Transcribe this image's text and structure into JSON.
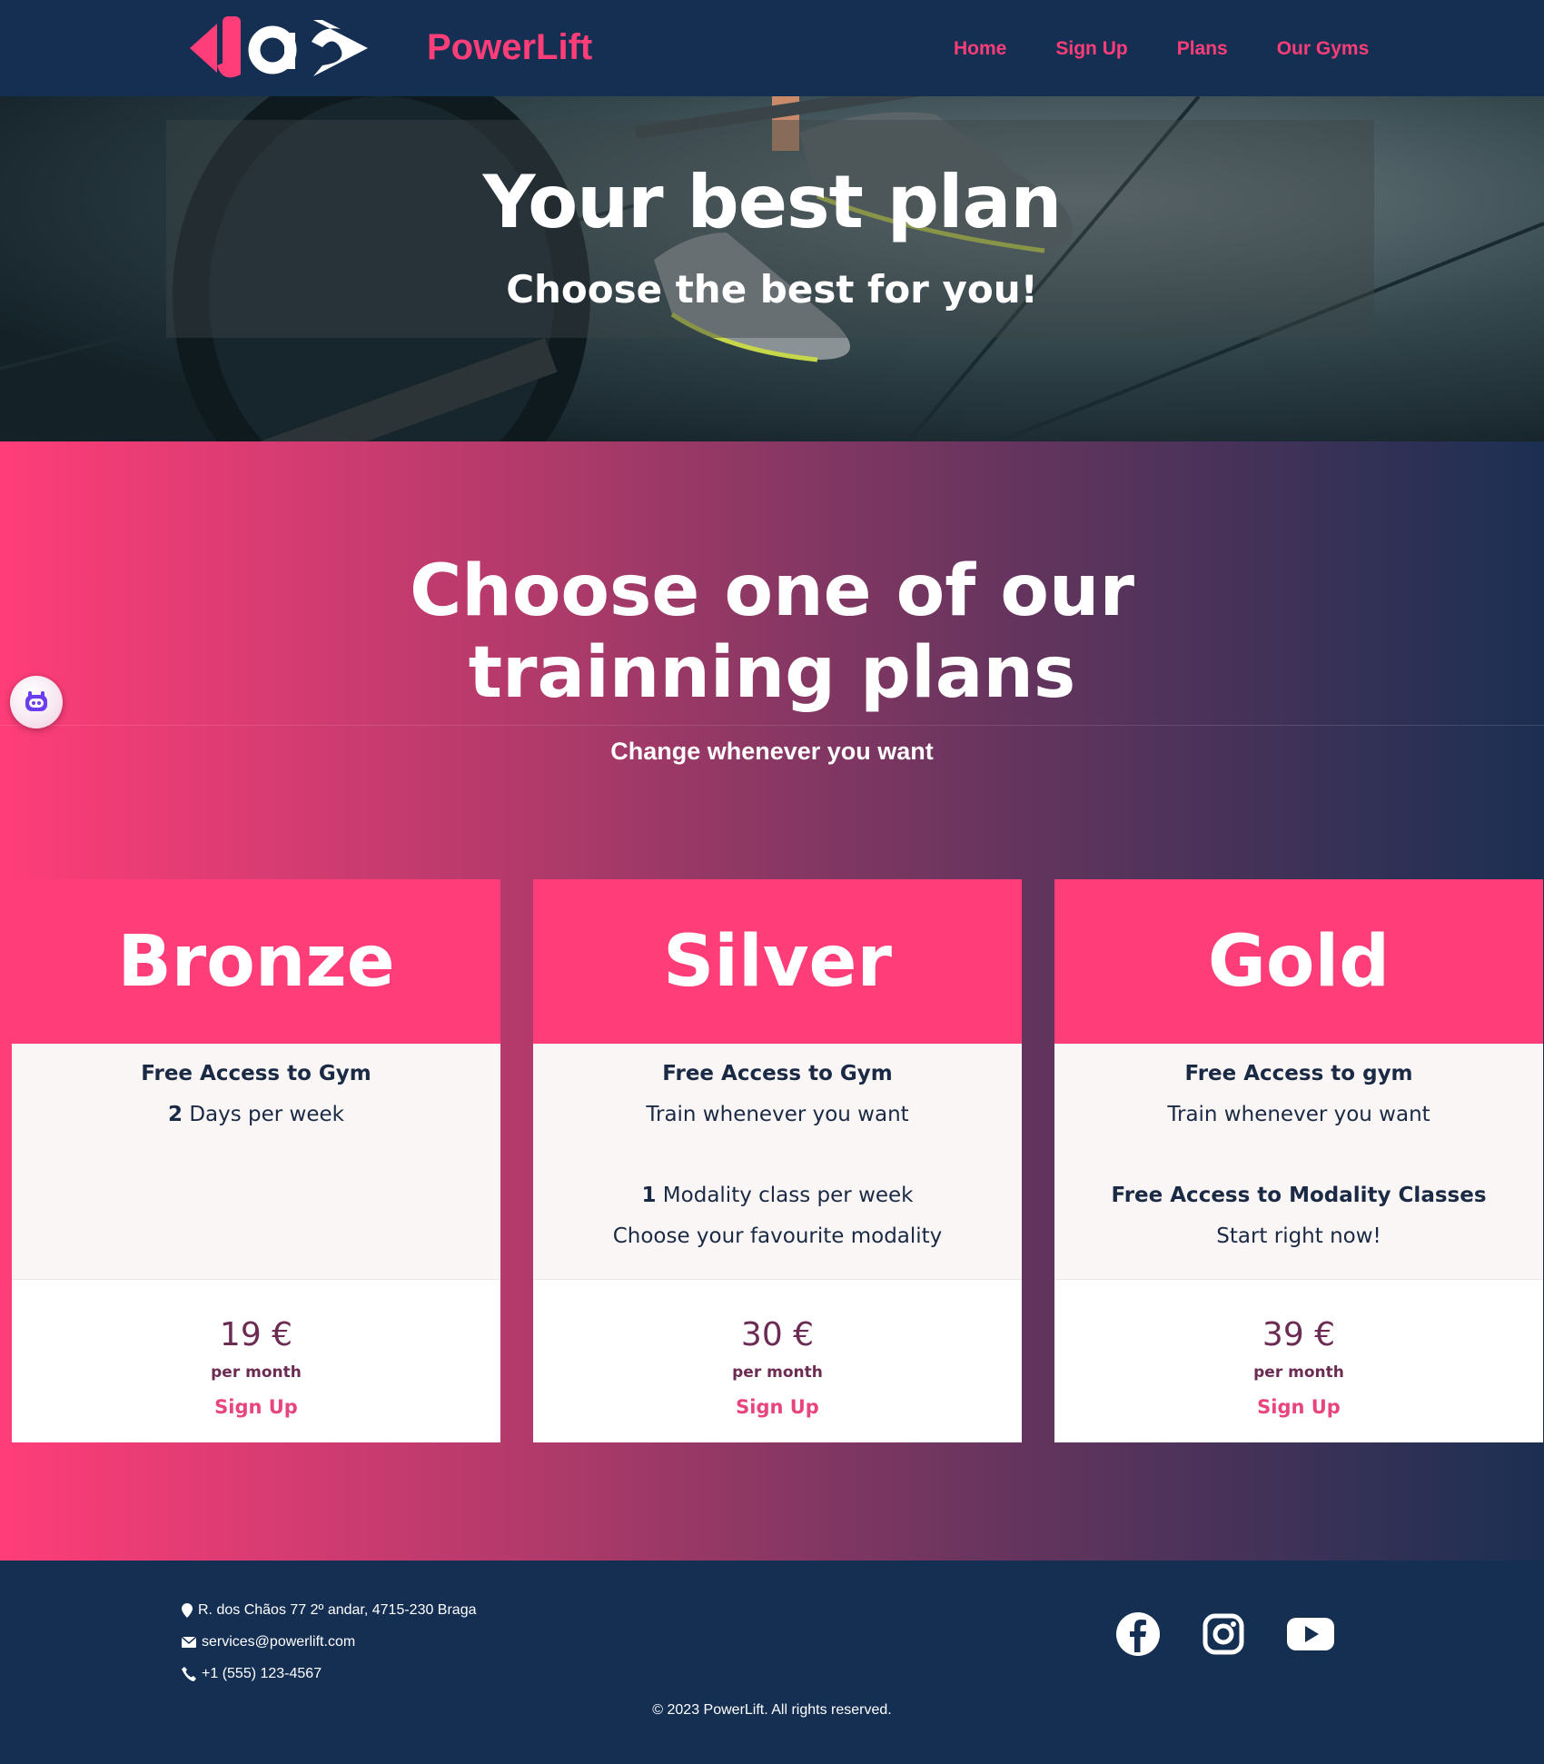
{
  "header": {
    "brand": "PowerLift",
    "nav": [
      "Home",
      "Sign Up",
      "Plans",
      "Our Gyms"
    ]
  },
  "hero": {
    "title": "Your best plan",
    "subtitle": "Choose the best for you!"
  },
  "plans_section": {
    "title": "Choose one of our trainning plans",
    "subtitle": "Change whenever you want"
  },
  "plans": [
    {
      "name": "Bronze",
      "line1": "Free Access to Gym",
      "line2_num": "2",
      "line2_text": " Days per week",
      "price": "19 €",
      "per": "per month",
      "cta": "Sign Up"
    },
    {
      "name": "Silver",
      "line1": "Free Access to Gym",
      "line2": "Train whenever you want",
      "line3_num": "1",
      "line3_text": " Modality class per week",
      "line4": "Choose your favourite modality",
      "price": "30 €",
      "per": "per month",
      "cta": "Sign Up"
    },
    {
      "name": "Gold",
      "line1": "Free Access to gym",
      "line2": "Train whenever you want",
      "line3": "Free Access to Modality Classes",
      "line4": "Start right now!",
      "price": "39 €",
      "per": "per month",
      "cta": "Sign Up"
    }
  ],
  "footer": {
    "address": "R. dos Chãos 77 2º andar, 4715-230 Braga",
    "email": "services@powerlift.com",
    "phone": "+1 (555) 123-4567",
    "social_icons": [
      "facebook-icon",
      "instagram-icon",
      "youtube-icon"
    ],
    "copyright": "© 2023 PowerLift. All rights reserved."
  },
  "colors": {
    "navy": "#142f52",
    "pink": "#ff3d79",
    "price": "#6b2b52"
  }
}
